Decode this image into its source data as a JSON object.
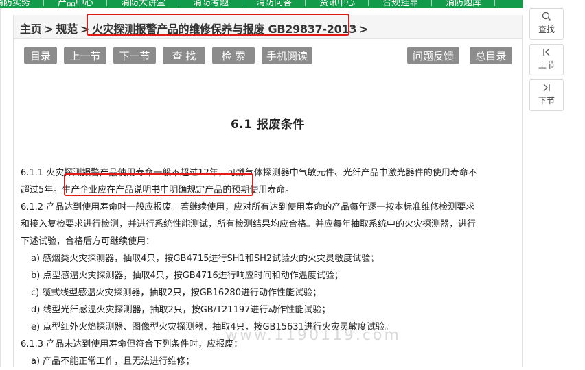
{
  "top_nav": {
    "items": [
      "消防实务",
      "产品中心",
      "消防大讲堂",
      "消防考题",
      "消防问答",
      "资讯中心",
      "合规挂靠",
      "消防题库"
    ]
  },
  "breadcrumb": {
    "home": "主页",
    "sep1": ">",
    "section": "规范",
    "sep2": ">",
    "doc_title": "火灾探测报警产品的维修保养与报废 GB29837-2013",
    "sep3": ">"
  },
  "toolbar": {
    "catalog": "目录",
    "prev_section": "上一节",
    "next_section": "下一节",
    "find": "查 找",
    "search": "检 索",
    "mobile_read": "手机阅读",
    "feedback": "问题反馈",
    "main_catalog": "总目录"
  },
  "section_heading": "6.1 报废条件",
  "body_lines": [
    "6.1.1 火灾探测报警产品使用寿命一般不超过12年，可燃气体探测器中气敏元件、光纤产品中激光器件的使用寿命不",
    "超过5年。生产企业应在产品说明书中明确规定产品的预期使用寿命。",
    "6.1.2 产品达到使用寿命时一般应报废。若继续使用，应对所有达到使用寿命的产品每年逐一按本标准维修检测要求",
    "和接入复检要求进行检测，并进行系统性能测试，所有检测结果均应合格。并应每年抽取系统中的火灾探测器，进行",
    "下述试验，合格后方可继续使用：",
    "a) 感烟类火灾探测器，抽取4只，按GB4715进行SH1和SH2试验火的火灾灵敏度试验；",
    "b) 点型感温火灾探测器，抽取4只，按GB4716进行响应时间和动作温度试验；",
    "c) 缆式线型感温火灾探测器，抽取2只，按GB16280进行动作性能试验；",
    "d) 线型光纤感温火灾探测器，抽取2只，按GB/T21197进行动作性能试验；",
    "e) 点型红外火焰探测器、图像型火灾探测器，抽取4只，按GB15631进行火灾灵敏度试验。",
    "6.1.3 产品未达到使用寿命但符合下列条件时，应报废：",
    "a) 产品不能正常工作，且无法进行维修；"
  ],
  "watermark": "www.1190119.com",
  "side_tools": {
    "search": {
      "icon": "search-icon",
      "label": "查找"
    },
    "prev": {
      "icon": "prev-icon",
      "label": "上节"
    },
    "next": {
      "icon": "next-icon",
      "label": "下节"
    }
  },
  "colors": {
    "nav_green": "#129b4a",
    "button_gray": "#8c8c8c",
    "highlight_red": "#e11a1a"
  }
}
